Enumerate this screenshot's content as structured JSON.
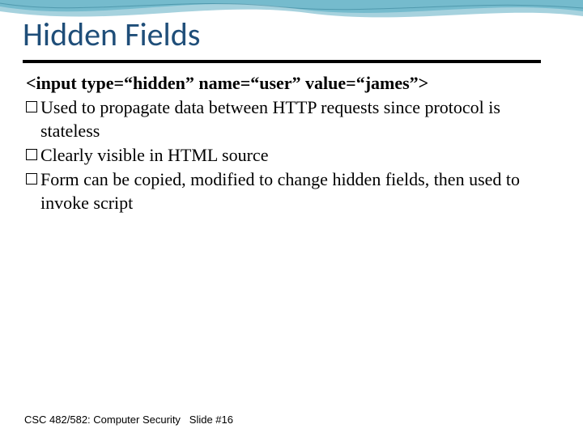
{
  "title": "Hidden Fields",
  "code_line": "<input type=“hidden” name=“user” value=“james”>",
  "bullets": {
    "b1": "Used to propagate data between HTTP requests since protocol is stateless",
    "b2": "Clearly visible in HTML source",
    "b3": "Form can be copied, modified to change hidden fields, then used to invoke script"
  },
  "footer": {
    "course": "CSC 482/582: Computer Security",
    "slide": "Slide #16"
  }
}
